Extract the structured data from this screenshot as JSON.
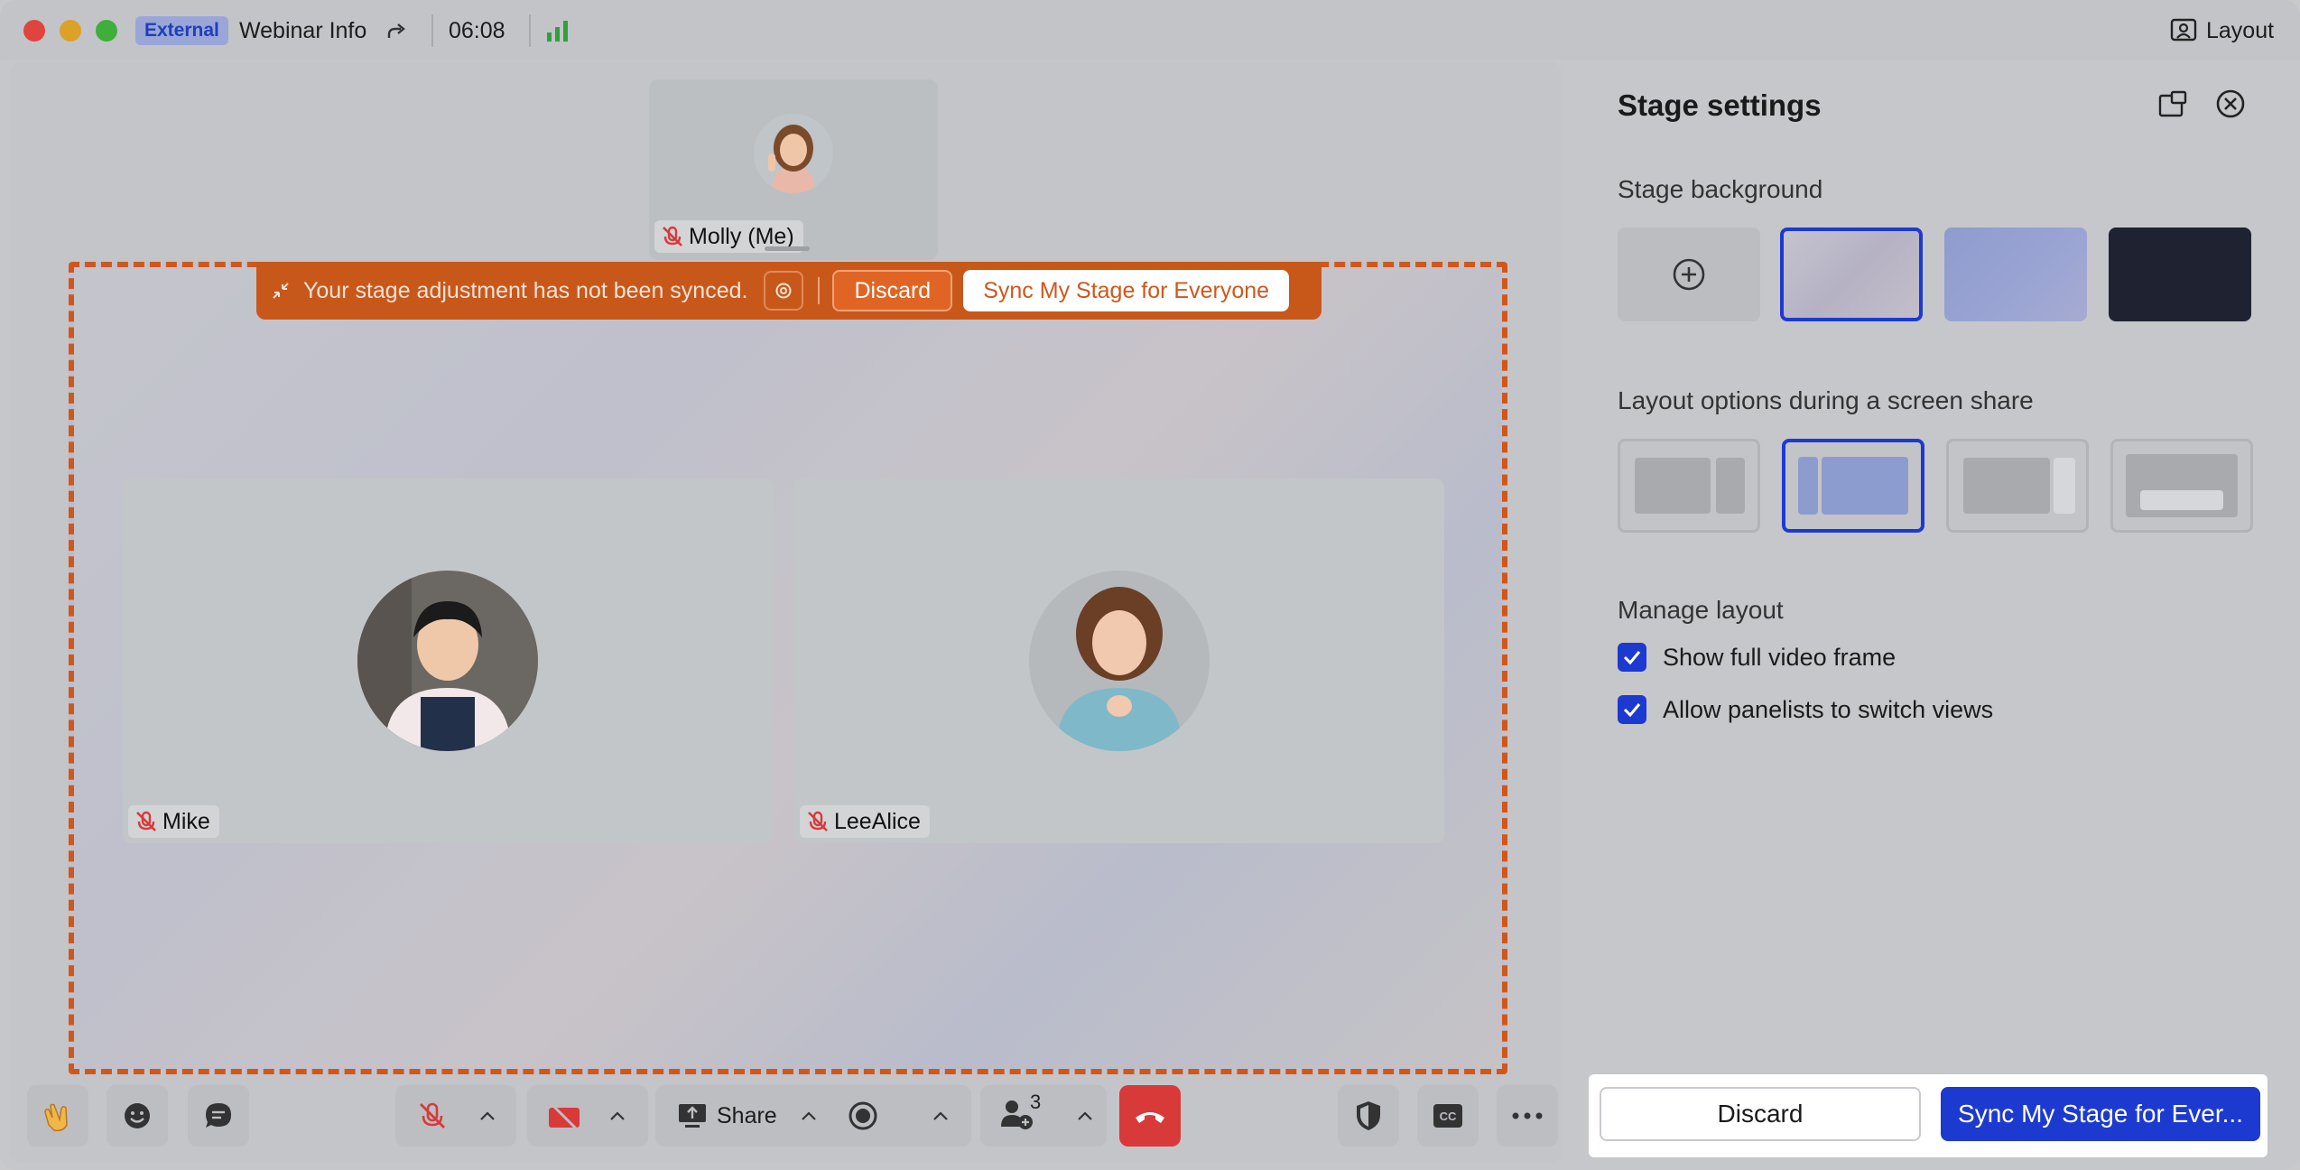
{
  "titlebar": {
    "badge": "External",
    "title": "Webinar Info",
    "timer": "06:08",
    "layout_label": "Layout"
  },
  "stage": {
    "self_name": "Molly  (Me)",
    "sync_bar": {
      "message": "Your stage adjustment has not been synced.",
      "discard_label": "Discard",
      "sync_label": "Sync My Stage for Everyone"
    },
    "participants": [
      {
        "name": "Mike"
      },
      {
        "name": "LeeAlice"
      }
    ]
  },
  "toolbar": {
    "share_label": "Share",
    "participants_count": "3",
    "mute_color": "#d83a3a"
  },
  "panel": {
    "title": "Stage settings",
    "bg_section": "Stage background",
    "layout_section": "Layout options during a screen share",
    "manage_section": "Manage layout",
    "checks": [
      {
        "label": "Show full video frame",
        "checked": true
      },
      {
        "label": "Allow panelists to switch views",
        "checked": true
      }
    ],
    "footer": {
      "discard_label": "Discard",
      "sync_label": "Sync My Stage for Ever..."
    }
  },
  "colors": {
    "accent": "#1d3ad0",
    "warning": "#c8581a"
  }
}
